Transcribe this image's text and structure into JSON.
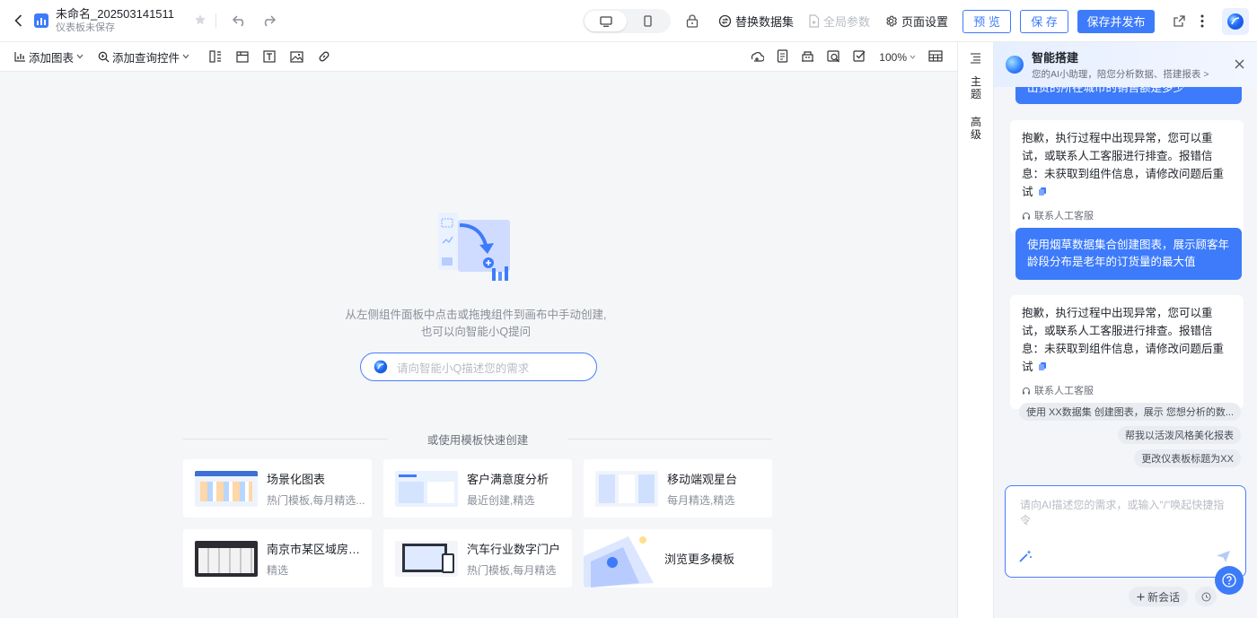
{
  "header": {
    "title": "未命名_202503141511",
    "subtitle": "仪表板未保存",
    "replace_dataset": "替换数据集",
    "global_params": "全局参数",
    "page_settings": "页面设置",
    "preview": "预 览",
    "save": "保 存",
    "save_publish": "保存并发布"
  },
  "toolbar": {
    "add_chart": "添加图表",
    "add_query": "添加查询控件",
    "zoom": "100%"
  },
  "canvas": {
    "empty_line1": "从左侧组件面板中点击或拖拽组件到画布中手动创建,",
    "empty_line2": "也可以向智能小Q提问",
    "ask_placeholder": "请向智能小Q描述您的需求",
    "template_divider": "或使用模板快速创建",
    "cards": [
      {
        "title": "场景化图表",
        "sub": "热门模板,每月精选..."
      },
      {
        "title": "客户满意度分析",
        "sub": "最近创建,精选"
      },
      {
        "title": "移动端观星台",
        "sub": "每月精选,精选"
      },
      {
        "title": "南京市某区域房屋...",
        "sub": "精选"
      },
      {
        "title": "汽车行业数字门户",
        "sub": "热门模板,每月精选"
      },
      {
        "title": "浏览更多模板",
        "sub": ""
      }
    ]
  },
  "side_tabs": {
    "theme": "主题",
    "advanced": "高级"
  },
  "ai": {
    "title": "智能搭建",
    "subtitle": "您的AI小助理，陪您分析数据、搭建报表 >",
    "msg_partial": "出货的所在城市的销售额是多少",
    "error_text": "抱歉，执行过程中出现异常，您可以重试，或联系人工客服进行排查。报错信息：未获取到组件信息，请修改问题后重试",
    "support_label": "联系人工客服",
    "user_msg": "使用烟草数据集合创建图表，展示顾客年龄段分布是老年的订货量的最大值",
    "chips": [
      "使用 XX数据集 创建图表，展示 您想分析的数...",
      "帮我以活泼风格美化报表",
      "更改仪表板标题为XX"
    ],
    "input_placeholder": "请向AI描述您的需求，或输入\"/\"唤起快捷指令",
    "new_chat": "新会话"
  }
}
